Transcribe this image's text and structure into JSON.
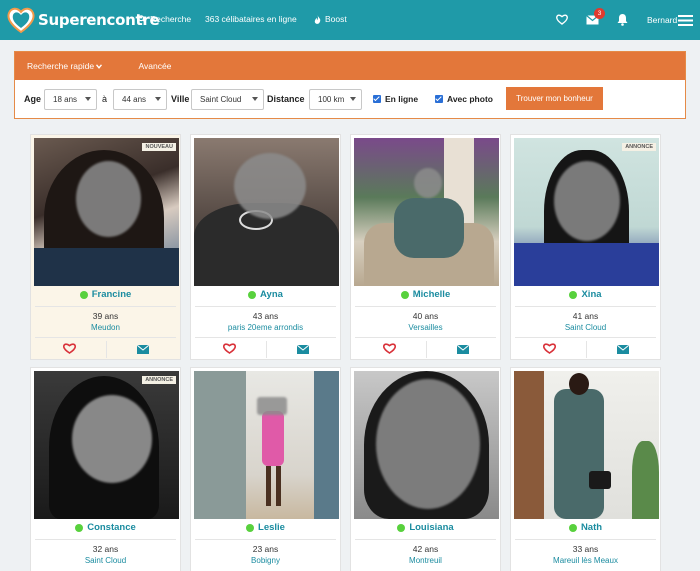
{
  "brand": {
    "logo_text": "Superencontre"
  },
  "nav": {
    "search_label": "Recherche",
    "online_label": "363 célibataires en ligne",
    "boost_label": "Boost",
    "messages_badge": "3",
    "user_name": "Bernard"
  },
  "search": {
    "tab_quick": "Recherche rapide",
    "tab_advanced": "Avancée",
    "age_label": "Age",
    "age_min": "18 ans",
    "to_label": "à",
    "age_max": "44 ans",
    "city_label": "Ville",
    "city_value": "Saint Cloud",
    "distance_label": "Distance",
    "distance_value": "100 km",
    "online_label": "En ligne",
    "photo_label": "Avec photo",
    "submit_label": "Trouver mon bonheur"
  },
  "profiles": [
    {
      "name": "Francine",
      "age": "39 ans",
      "city": "Meudon",
      "tag": "NOUVEAU"
    },
    {
      "name": "Ayna",
      "age": "43 ans",
      "city": "paris 20eme arrondis",
      "tag": ""
    },
    {
      "name": "Michelle",
      "age": "40 ans",
      "city": "Versailles",
      "tag": ""
    },
    {
      "name": "Xina",
      "age": "41 ans",
      "city": "Saint Cloud",
      "tag": "ANNONCE"
    },
    {
      "name": "Constance",
      "age": "32 ans",
      "city": "Saint Cloud",
      "tag": "ANNONCE"
    },
    {
      "name": "Leslie",
      "age": "23 ans",
      "city": "Bobigny",
      "tag": ""
    },
    {
      "name": "Louisiana",
      "age": "42 ans",
      "city": "Montreuil",
      "tag": ""
    },
    {
      "name": "Nath",
      "age": "33 ans",
      "city": "Mareuil lès Meaux",
      "tag": ""
    }
  ],
  "colors": {
    "header_bg": "#1f9aa8",
    "accent_orange": "#e3773a",
    "link_teal": "#1b8ca0",
    "online_dot": "#58d13d",
    "heart_red": "#d9323a"
  }
}
